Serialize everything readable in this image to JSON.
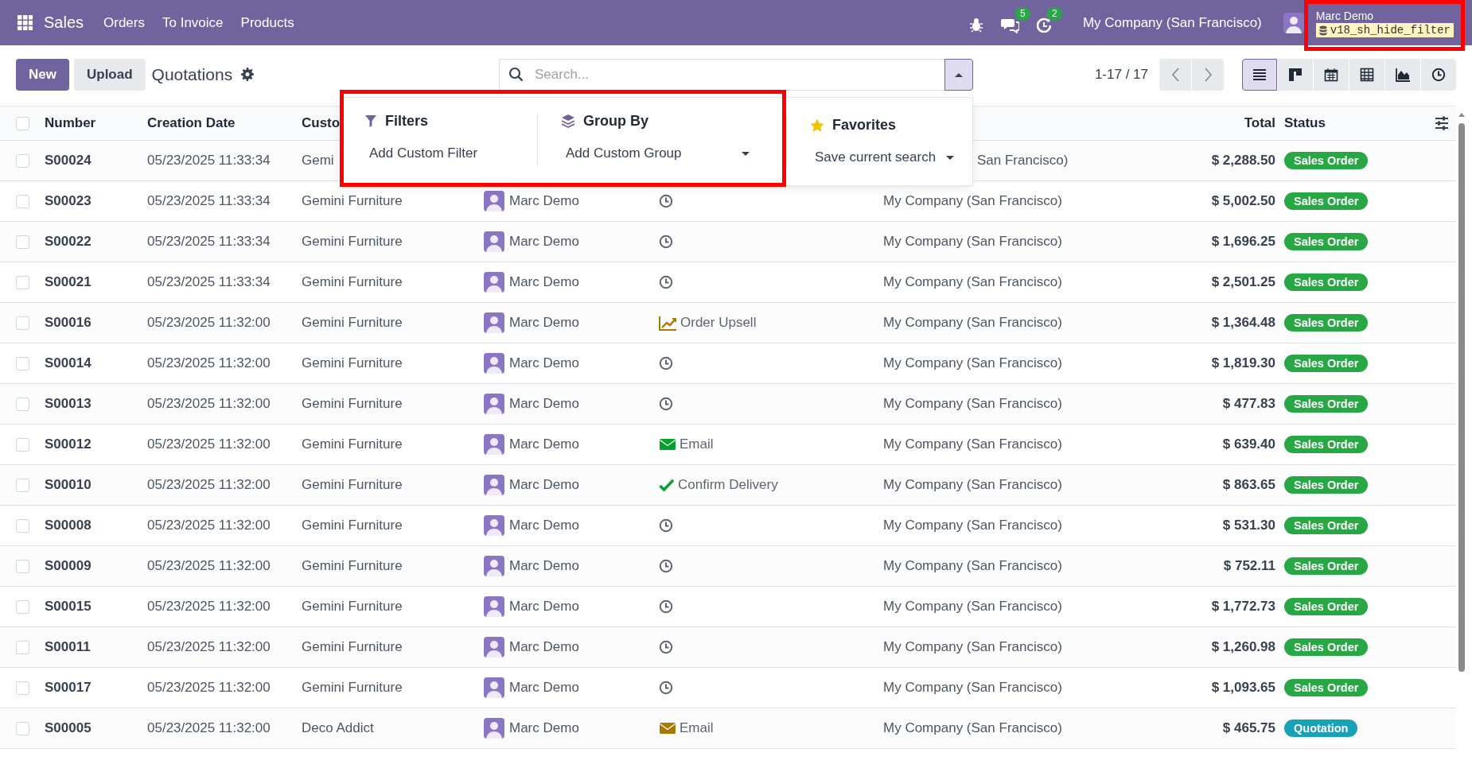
{
  "navbar": {
    "app": "Sales",
    "menu": [
      "Orders",
      "To Invoice",
      "Products"
    ],
    "systray": [
      {
        "kind": "debug"
      },
      {
        "kind": "messages",
        "count": "5"
      },
      {
        "kind": "activities",
        "count": "2"
      }
    ],
    "company": "My Company (San Francisco)",
    "user": {
      "name": "Marc Demo",
      "database": "v18_sh_hide_filter",
      "highlighted": true
    }
  },
  "control_panel": {
    "buttons": [
      {
        "label": "New",
        "kind": "primary"
      },
      {
        "label": "Upload",
        "kind": "secondary"
      }
    ],
    "title": "Quotations",
    "search": {
      "placeholder": "Search...",
      "panel_open": true
    },
    "pager": "1-17 / 17",
    "views": [
      {
        "kind": "list",
        "selected": true
      },
      {
        "kind": "kanban",
        "selected": false
      },
      {
        "kind": "calendar",
        "selected": false
      },
      {
        "kind": "pivot",
        "selected": false
      },
      {
        "kind": "graph",
        "selected": false
      },
      {
        "kind": "activity",
        "selected": false
      }
    ]
  },
  "search_panel": {
    "sections": [
      {
        "kind": "filters",
        "title": "Filters",
        "item": "Add Custom Filter",
        "highlighted": true
      },
      {
        "kind": "group_by",
        "title": "Group By",
        "item": "Add Custom Group",
        "highlighted": true
      },
      {
        "kind": "favorites",
        "title": "Favorites",
        "item": "Save current search",
        "highlighted": false
      }
    ]
  },
  "table": {
    "all_selected": false,
    "columns": [
      {
        "kind": "number",
        "label": "Number"
      },
      {
        "kind": "date",
        "label": "Creation Date"
      },
      {
        "kind": "customer",
        "label": "Custo"
      },
      {
        "kind": "total",
        "label": "Total"
      },
      {
        "kind": "status",
        "label": "Status"
      }
    ],
    "rows": [
      {
        "selected": false,
        "number": "S00024",
        "date": "05/23/2025 11:33:34",
        "customer": "Gemi",
        "company": "San Francisco)",
        "total": "$ 2,288.50",
        "status": {
          "label": "Sales Order",
          "color": "#28a745"
        }
      },
      {
        "selected": false,
        "number": "S00023",
        "date": "05/23/2025 11:33:34",
        "customer": "Gemini Furniture",
        "salesperson": "Marc Demo",
        "activity": {
          "kind": "none"
        },
        "company": "My Company (San Francisco)",
        "total": "$ 5,002.50",
        "status": {
          "label": "Sales Order",
          "color": "#28a745"
        }
      },
      {
        "selected": false,
        "number": "S00022",
        "date": "05/23/2025 11:33:34",
        "customer": "Gemini Furniture",
        "salesperson": "Marc Demo",
        "activity": {
          "kind": "none"
        },
        "company": "My Company (San Francisco)",
        "total": "$ 1,696.25",
        "status": {
          "label": "Sales Order",
          "color": "#28a745"
        }
      },
      {
        "selected": false,
        "number": "S00021",
        "date": "05/23/2025 11:33:34",
        "customer": "Gemini Furniture",
        "salesperson": "Marc Demo",
        "activity": {
          "kind": "none"
        },
        "company": "My Company (San Francisco)",
        "total": "$ 2,501.25",
        "status": {
          "label": "Sales Order",
          "color": "#28a745"
        }
      },
      {
        "selected": false,
        "number": "S00016",
        "date": "05/23/2025 11:32:00",
        "customer": "Gemini Furniture",
        "salesperson": "Marc Demo",
        "activity": {
          "kind": "upsell",
          "label": "Order Upsell",
          "color": "#a87b00"
        },
        "company": "My Company (San Francisco)",
        "total": "$ 1,364.48",
        "status": {
          "label": "Sales Order",
          "color": "#28a745"
        }
      },
      {
        "selected": false,
        "number": "S00014",
        "date": "05/23/2025 11:32:00",
        "customer": "Gemini Furniture",
        "salesperson": "Marc Demo",
        "activity": {
          "kind": "none"
        },
        "company": "My Company (San Francisco)",
        "total": "$ 1,819.30",
        "status": {
          "label": "Sales Order",
          "color": "#28a745"
        }
      },
      {
        "selected": false,
        "number": "S00013",
        "date": "05/23/2025 11:32:00",
        "customer": "Gemini Furniture",
        "salesperson": "Marc Demo",
        "activity": {
          "kind": "none"
        },
        "company": "My Company (San Francisco)",
        "total": "$ 477.83",
        "status": {
          "label": "Sales Order",
          "color": "#28a745"
        }
      },
      {
        "selected": false,
        "number": "S00012",
        "date": "05/23/2025 11:32:00",
        "customer": "Gemini Furniture",
        "salesperson": "Marc Demo",
        "activity": {
          "kind": "email",
          "label": "Email",
          "color": "#00a32e"
        },
        "company": "My Company (San Francisco)",
        "total": "$ 639.40",
        "status": {
          "label": "Sales Order",
          "color": "#28a745"
        }
      },
      {
        "selected": false,
        "number": "S00010",
        "date": "05/23/2025 11:32:00",
        "customer": "Gemini Furniture",
        "salesperson": "Marc Demo",
        "activity": {
          "kind": "check",
          "label": "Confirm Delivery",
          "color": "#00a32e"
        },
        "company": "My Company (San Francisco)",
        "total": "$ 863.65",
        "status": {
          "label": "Sales Order",
          "color": "#28a745"
        }
      },
      {
        "selected": false,
        "number": "S00008",
        "date": "05/23/2025 11:32:00",
        "customer": "Gemini Furniture",
        "salesperson": "Marc Demo",
        "activity": {
          "kind": "none"
        },
        "company": "My Company (San Francisco)",
        "total": "$ 531.30",
        "status": {
          "label": "Sales Order",
          "color": "#28a745"
        }
      },
      {
        "selected": false,
        "number": "S00009",
        "date": "05/23/2025 11:32:00",
        "customer": "Gemini Furniture",
        "salesperson": "Marc Demo",
        "activity": {
          "kind": "none"
        },
        "company": "My Company (San Francisco)",
        "total": "$ 752.11",
        "status": {
          "label": "Sales Order",
          "color": "#28a745"
        }
      },
      {
        "selected": false,
        "number": "S00015",
        "date": "05/23/2025 11:32:00",
        "customer": "Gemini Furniture",
        "salesperson": "Marc Demo",
        "activity": {
          "kind": "none"
        },
        "company": "My Company (San Francisco)",
        "total": "$ 1,772.73",
        "status": {
          "label": "Sales Order",
          "color": "#28a745"
        }
      },
      {
        "selected": false,
        "number": "S00011",
        "date": "05/23/2025 11:32:00",
        "customer": "Gemini Furniture",
        "salesperson": "Marc Demo",
        "activity": {
          "kind": "none"
        },
        "company": "My Company (San Francisco)",
        "total": "$ 1,260.98",
        "status": {
          "label": "Sales Order",
          "color": "#28a745"
        }
      },
      {
        "selected": false,
        "number": "S00017",
        "date": "05/23/2025 11:32:00",
        "customer": "Gemini Furniture",
        "salesperson": "Marc Demo",
        "activity": {
          "kind": "none"
        },
        "company": "My Company (San Francisco)",
        "total": "$ 1,093.65",
        "status": {
          "label": "Sales Order",
          "color": "#28a745"
        }
      },
      {
        "selected": false,
        "number": "S00005",
        "date": "05/23/2025 11:32:00",
        "customer": "Deco Addict",
        "salesperson": "Marc Demo",
        "activity": {
          "kind": "email",
          "label": "Email",
          "color": "#a87b00"
        },
        "company": "My Company (San Francisco)",
        "total": "$ 465.75",
        "status": {
          "label": "Quotation",
          "color": "#17a2b8"
        }
      }
    ]
  }
}
